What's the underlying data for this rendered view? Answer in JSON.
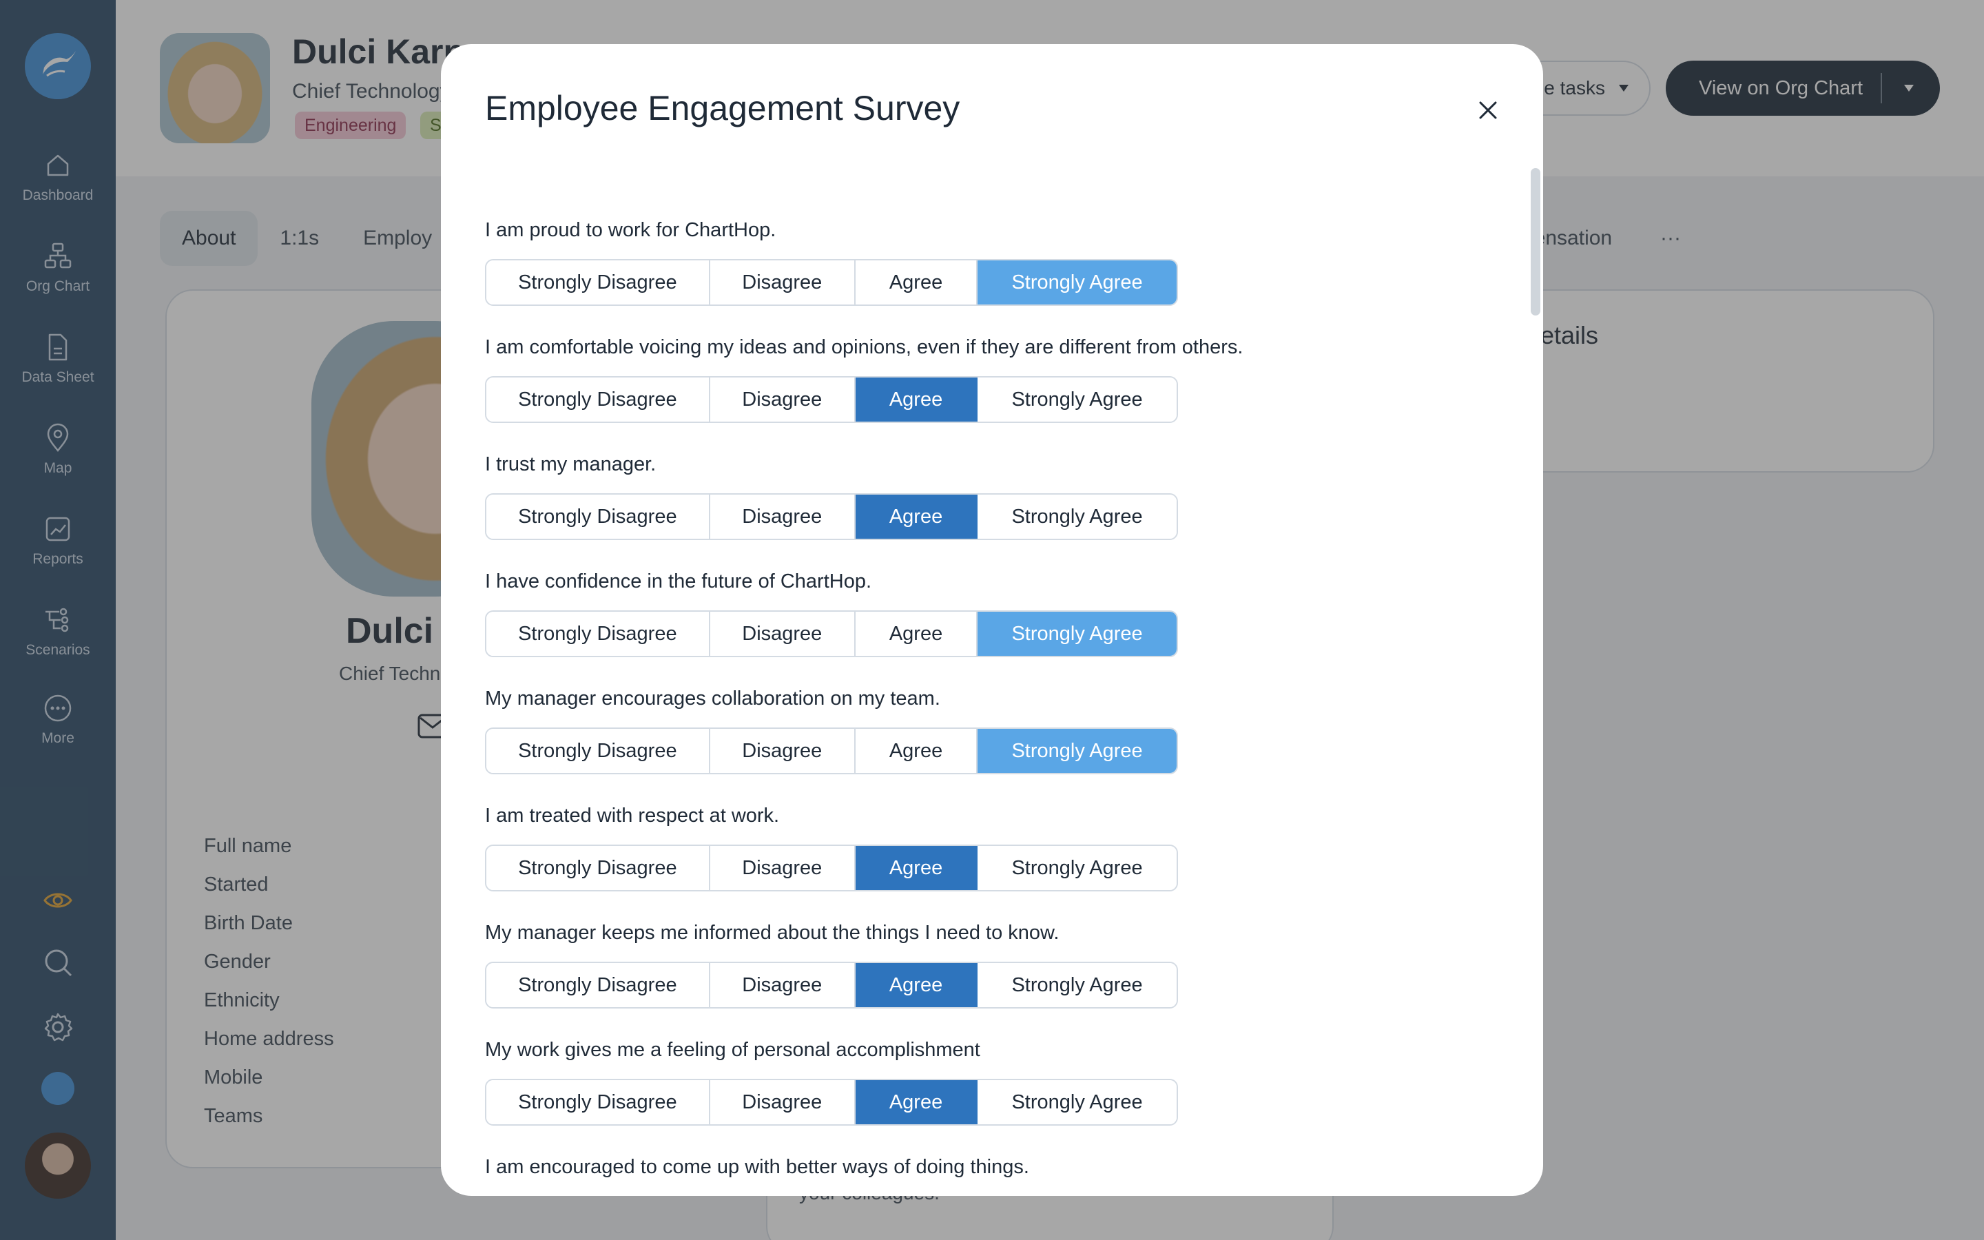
{
  "sidebar": {
    "items": [
      {
        "label": "Dashboard",
        "icon": "home-icon"
      },
      {
        "label": "Org Chart",
        "icon": "org-chart-icon"
      },
      {
        "label": "Data Sheet",
        "icon": "document-icon"
      },
      {
        "label": "Map",
        "icon": "map-pin-icon"
      },
      {
        "label": "Reports",
        "icon": "reports-icon"
      },
      {
        "label": "Scenarios",
        "icon": "scenarios-icon"
      },
      {
        "label": "More",
        "icon": "more-icon"
      }
    ]
  },
  "header": {
    "name": "Dulci Karn",
    "title": "Chief Technology",
    "tags": [
      "Engineering",
      "S"
    ],
    "tasks_button": "e tasks",
    "org_chart_button": "View on Org Chart"
  },
  "tabs": [
    "About",
    "1:1s",
    "Employ"
  ],
  "tab_right": "pensation",
  "tab_more": "···",
  "profile_card": {
    "name": "Dulci I",
    "title": "Chief Techn",
    "fields": [
      "Full name",
      "Started",
      "Birth Date",
      "Gender",
      "Ethnicity",
      "Home address",
      "Mobile",
      "Teams"
    ]
  },
  "right_card_title": "etails",
  "bottom_card_text": "your colleagues.",
  "modal": {
    "title": "Employee Engagement Survey",
    "options": [
      "Strongly Disagree",
      "Disagree",
      "Agree",
      "Strongly Agree"
    ],
    "questions": [
      {
        "text": "I am proud to work for ChartHop.",
        "selected": "Strongly Agree"
      },
      {
        "text": "I am comfortable voicing my ideas and opinions, even if they are different from others.",
        "selected": "Agree"
      },
      {
        "text": "I trust my manager.",
        "selected": "Agree"
      },
      {
        "text": "I have confidence in the future of ChartHop.",
        "selected": "Strongly Agree"
      },
      {
        "text": "My manager encourages collaboration on my team.",
        "selected": "Strongly Agree"
      },
      {
        "text": "I am treated with respect at work.",
        "selected": "Agree"
      },
      {
        "text": "My manager keeps me informed about the things I need to know.",
        "selected": "Agree"
      },
      {
        "text": "My work gives me a feeling of personal accomplishment",
        "selected": "Agree"
      },
      {
        "text": "I am encouraged to come up with better ways of doing things.",
        "selected": null
      }
    ]
  },
  "colors": {
    "sidebar": "#2a4a66",
    "agree_selected": "#2e74bd",
    "strongly_agree_selected": "#5aa6e6",
    "accent_eye": "#e0a030"
  }
}
